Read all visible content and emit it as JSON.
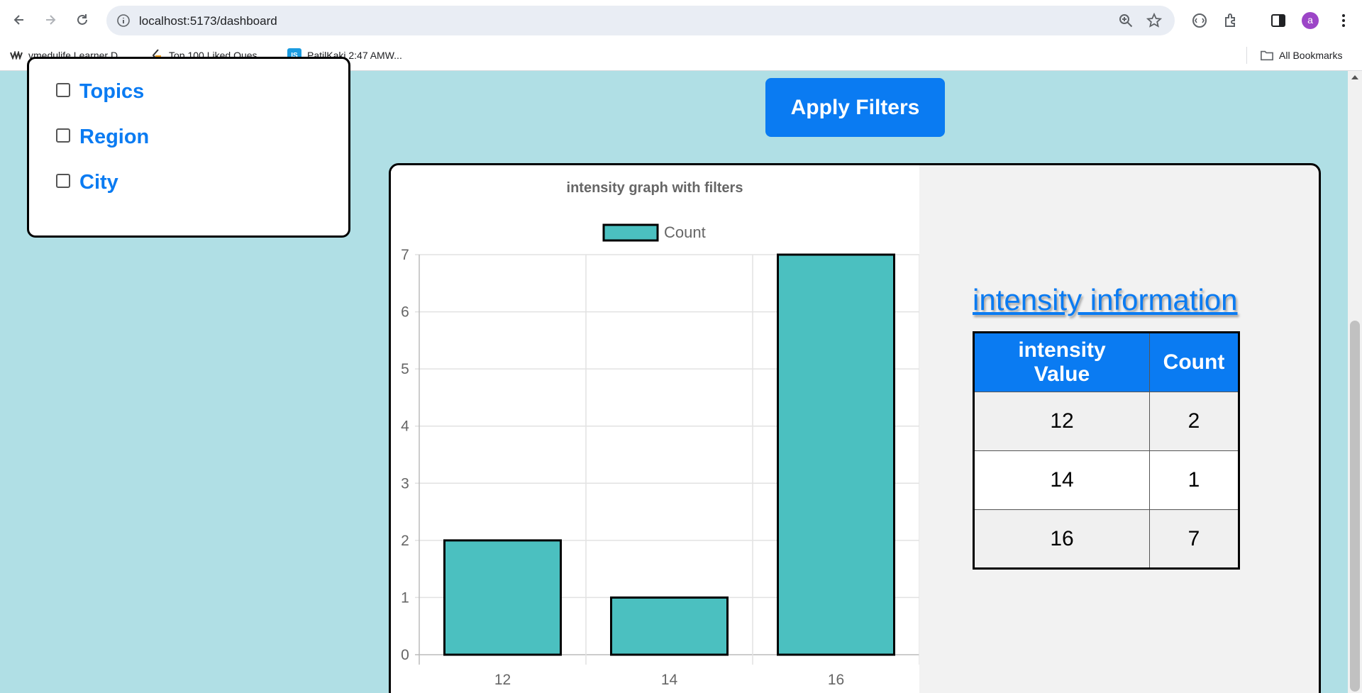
{
  "browser": {
    "url": "localhost:5173/dashboard",
    "profile_initial": "a",
    "bookmarks": [
      {
        "label": "vmedulife Learner D...",
        "icon": "vm-logo"
      },
      {
        "label": "Top 100 Liked Ques...",
        "icon": "leetcode-logo"
      },
      {
        "label": "PatilKaki 2:47 AMW...",
        "icon": "is-logo"
      }
    ],
    "all_bookmarks_label": "All Bookmarks"
  },
  "filters": {
    "options": [
      {
        "label": "Topics",
        "checked": false
      },
      {
        "label": "Region",
        "checked": false
      },
      {
        "label": "City",
        "checked": false
      }
    ],
    "apply_label": "Apply Filters"
  },
  "chart_data": {
    "type": "bar",
    "title": "intensity graph with filters",
    "categories": [
      "12",
      "14",
      "16"
    ],
    "series": [
      {
        "name": "Count",
        "values": [
          2,
          1,
          7
        ],
        "color": "#4bc0c0"
      }
    ],
    "ylim": [
      0,
      7
    ],
    "yticks": [
      0,
      1,
      2,
      3,
      4,
      5,
      6,
      7
    ],
    "grid": true,
    "legend": "top"
  },
  "info": {
    "title": "intensity information",
    "headers": [
      "intensity Value",
      "Count"
    ],
    "rows": [
      {
        "value": "12",
        "count": "2"
      },
      {
        "value": "14",
        "count": "1"
      },
      {
        "value": "16",
        "count": "7"
      }
    ]
  },
  "colors": {
    "accent": "#0a7bf2",
    "page_bg": "#b0dfe5",
    "bar_fill": "#4bc0c0"
  }
}
